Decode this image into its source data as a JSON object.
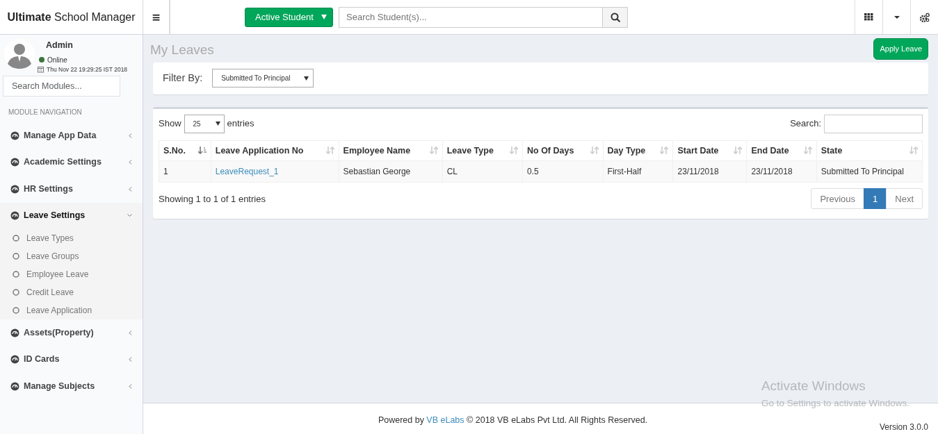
{
  "brand": {
    "bold": "Ultimate",
    "rest": "School Manager"
  },
  "topbar": {
    "menu_glyph": "≡",
    "student_button": "Active Student",
    "search": {
      "placeholder": "Search Student(s)..."
    }
  },
  "user": {
    "name": "Admin",
    "status": "Online",
    "online": true,
    "datetime": "Thu Nov 22 19:29:25 IST 2018"
  },
  "sidebar": {
    "search": {
      "placeholder": "Search Modules..."
    },
    "header": "MODULE NAVIGATION",
    "items": [
      {
        "label": "Manage App Data",
        "expanded": false
      },
      {
        "label": "Academic Settings",
        "expanded": false
      },
      {
        "label": "HR Settings",
        "expanded": false
      },
      {
        "label": "Leave Settings",
        "expanded": true,
        "children": [
          {
            "label": "Leave Types"
          },
          {
            "label": "Leave Groups"
          },
          {
            "label": "Employee Leave"
          },
          {
            "label": "Credit Leave"
          },
          {
            "label": "Leave Application"
          }
        ]
      },
      {
        "label": "Assets(Property)",
        "expanded": false
      },
      {
        "label": "ID Cards",
        "expanded": false
      },
      {
        "label": "Manage Subjects",
        "expanded": false
      }
    ]
  },
  "page": {
    "title": "My Leaves",
    "apply_button": "Apply Leave"
  },
  "filter": {
    "label": "Filter By:",
    "value": "Submitted To Principal"
  },
  "table": {
    "show_label": "Show",
    "page_size": "25",
    "entries_label": "entries",
    "search_label": "Search:",
    "columns": [
      {
        "label": "S.No.",
        "sorted": true
      },
      {
        "label": "Leave Application No",
        "sorted": false
      },
      {
        "label": "Employee Name",
        "sorted": false
      },
      {
        "label": "Leave Type",
        "sorted": false
      },
      {
        "label": "No Of Days",
        "sorted": false
      },
      {
        "label": "Day Type",
        "sorted": false
      },
      {
        "label": "Start Date",
        "sorted": false
      },
      {
        "label": "End Date",
        "sorted": false
      },
      {
        "label": "State",
        "sorted": false
      }
    ],
    "rows": [
      [
        {
          "kind": "text",
          "text": "1"
        },
        {
          "kind": "link",
          "text": "LeaveRequest_1"
        },
        {
          "kind": "text",
          "text": "Sebastian George"
        },
        {
          "kind": "text",
          "text": "CL"
        },
        {
          "kind": "text",
          "text": "0.5"
        },
        {
          "kind": "text",
          "text": "First-Half"
        },
        {
          "kind": "text",
          "text": "23/11/2018"
        },
        {
          "kind": "text",
          "text": "23/11/2018"
        },
        {
          "kind": "text",
          "text": "Submitted To Principal"
        }
      ]
    ],
    "info": "Showing 1 to 1 of 1 entries",
    "pagination": [
      {
        "label": "Previous",
        "selected": false
      },
      {
        "label": "1",
        "selected": true
      },
      {
        "label": "Next",
        "selected": false
      }
    ]
  },
  "footer": {
    "powered": "Powered by",
    "link": "VB eLabs",
    "copyright": "© 2018 VB eLabs Pvt Ltd. All Rights Reserved.",
    "version": "Version 3.0.0"
  },
  "os_overlay": {
    "title": "Activate Windows",
    "message": "Go to Settings to activate Windows."
  }
}
